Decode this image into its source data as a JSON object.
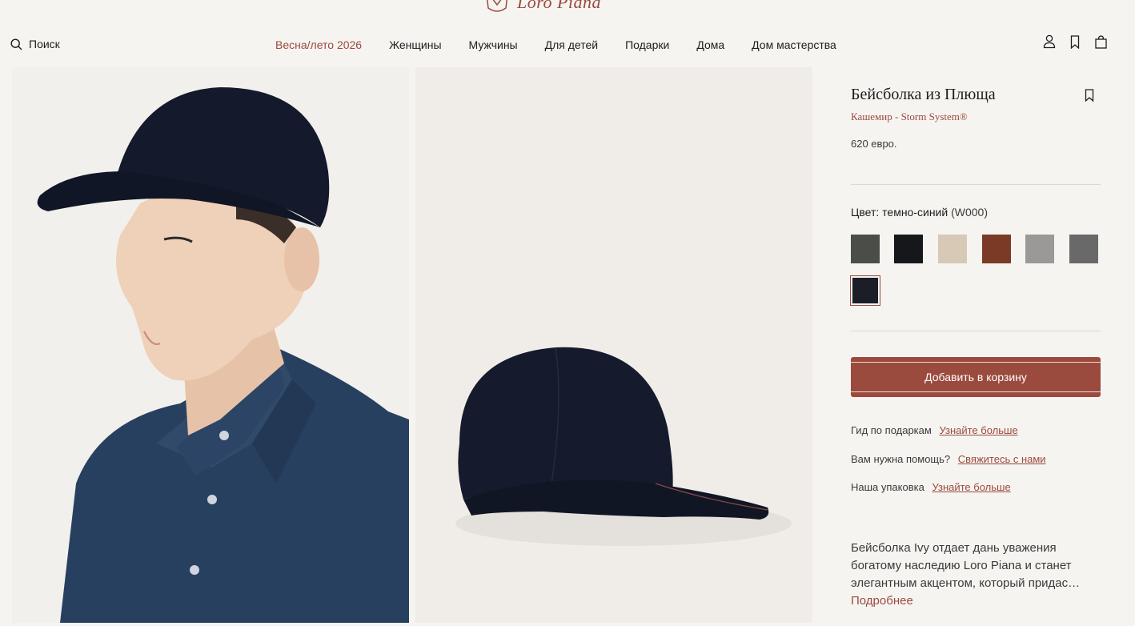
{
  "brand": {
    "name": "Loro Piana"
  },
  "header": {
    "search_label": "Поиск",
    "nav": [
      {
        "label": "Весна/лето 2026",
        "accent": true
      },
      {
        "label": "Женщины"
      },
      {
        "label": "Мужчины"
      },
      {
        "label": "Для детей"
      },
      {
        "label": "Подарки"
      },
      {
        "label": "Дома"
      },
      {
        "label": "Дом мастерства"
      }
    ],
    "icons": [
      "user-icon",
      "bookmark-icon",
      "bag-icon"
    ]
  },
  "product": {
    "title": "Бейсболка из Плюща",
    "material": "Кашемир - Storm System®",
    "price": "620 евро.",
    "color_label": "Цвет: темно-синий",
    "color_code": "(W000)",
    "swatches": [
      {
        "color": "#4b4d49"
      },
      {
        "color": "#15171b"
      },
      {
        "color": "#d8c8b6"
      },
      {
        "color": "#7a3a25"
      },
      {
        "color": "#9a9998"
      },
      {
        "color": "#69696a"
      },
      {
        "color": "#1b1e29",
        "selected": true
      }
    ],
    "add_to_cart": "Добавить в корзину",
    "info": [
      {
        "text": "Гид по подаркам",
        "link": "Узнайте больше"
      },
      {
        "text": "Вам нужна помощь?",
        "link": "Свяжитесь с нами"
      },
      {
        "text": "Наша упаковка",
        "link": "Узнайте больше"
      }
    ],
    "description": "Бейсболка Ivy отдает дань уважения богатому наследию Loro Piana и станет элегантным акцентом, который придас…",
    "more_label": "Подробнее"
  },
  "colors": {
    "accent": "#9b4a3e",
    "background": "#f6f4f1"
  }
}
